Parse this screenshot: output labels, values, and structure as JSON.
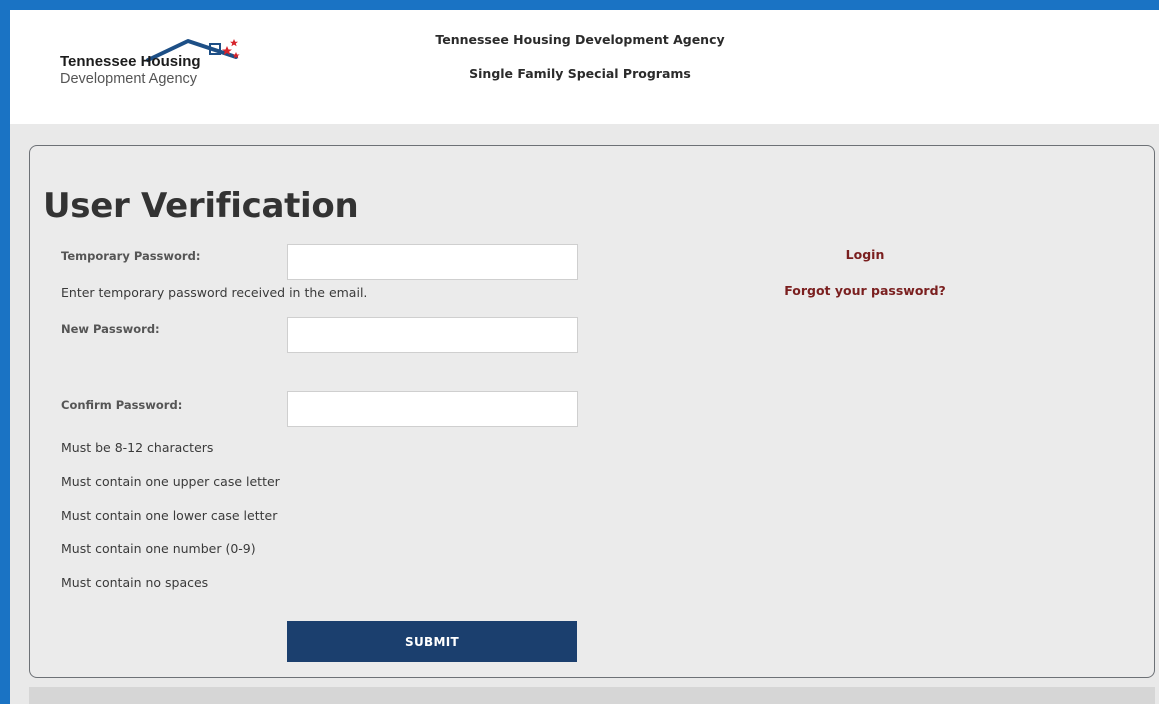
{
  "header": {
    "logo_line1": "Tennessee Housing",
    "logo_line2": "Development Agency",
    "title": "Tennessee Housing Development Agency",
    "subtitle": "Single Family Special Programs"
  },
  "form": {
    "title": "User Verification",
    "temporary_password": {
      "label": "Temporary Password:",
      "value": "",
      "hint": "Enter temporary password received in the email."
    },
    "new_password": {
      "label": "New Password:",
      "value": ""
    },
    "confirm_password": {
      "label": "Confirm Password:",
      "value": ""
    },
    "rules": [
      "Must be 8-12 characters",
      "Must contain one upper case letter",
      "Must contain one lower case letter",
      "Must contain one number (0-9)",
      "Must contain no spaces"
    ],
    "submit_label": "SUBMIT"
  },
  "links": {
    "login": "Login",
    "forgot": "Forgot your password?"
  },
  "colors": {
    "frame": "#1a73c4",
    "button": "#1b3f6e",
    "link": "#7a1f1f",
    "background": "#ebebeb"
  }
}
